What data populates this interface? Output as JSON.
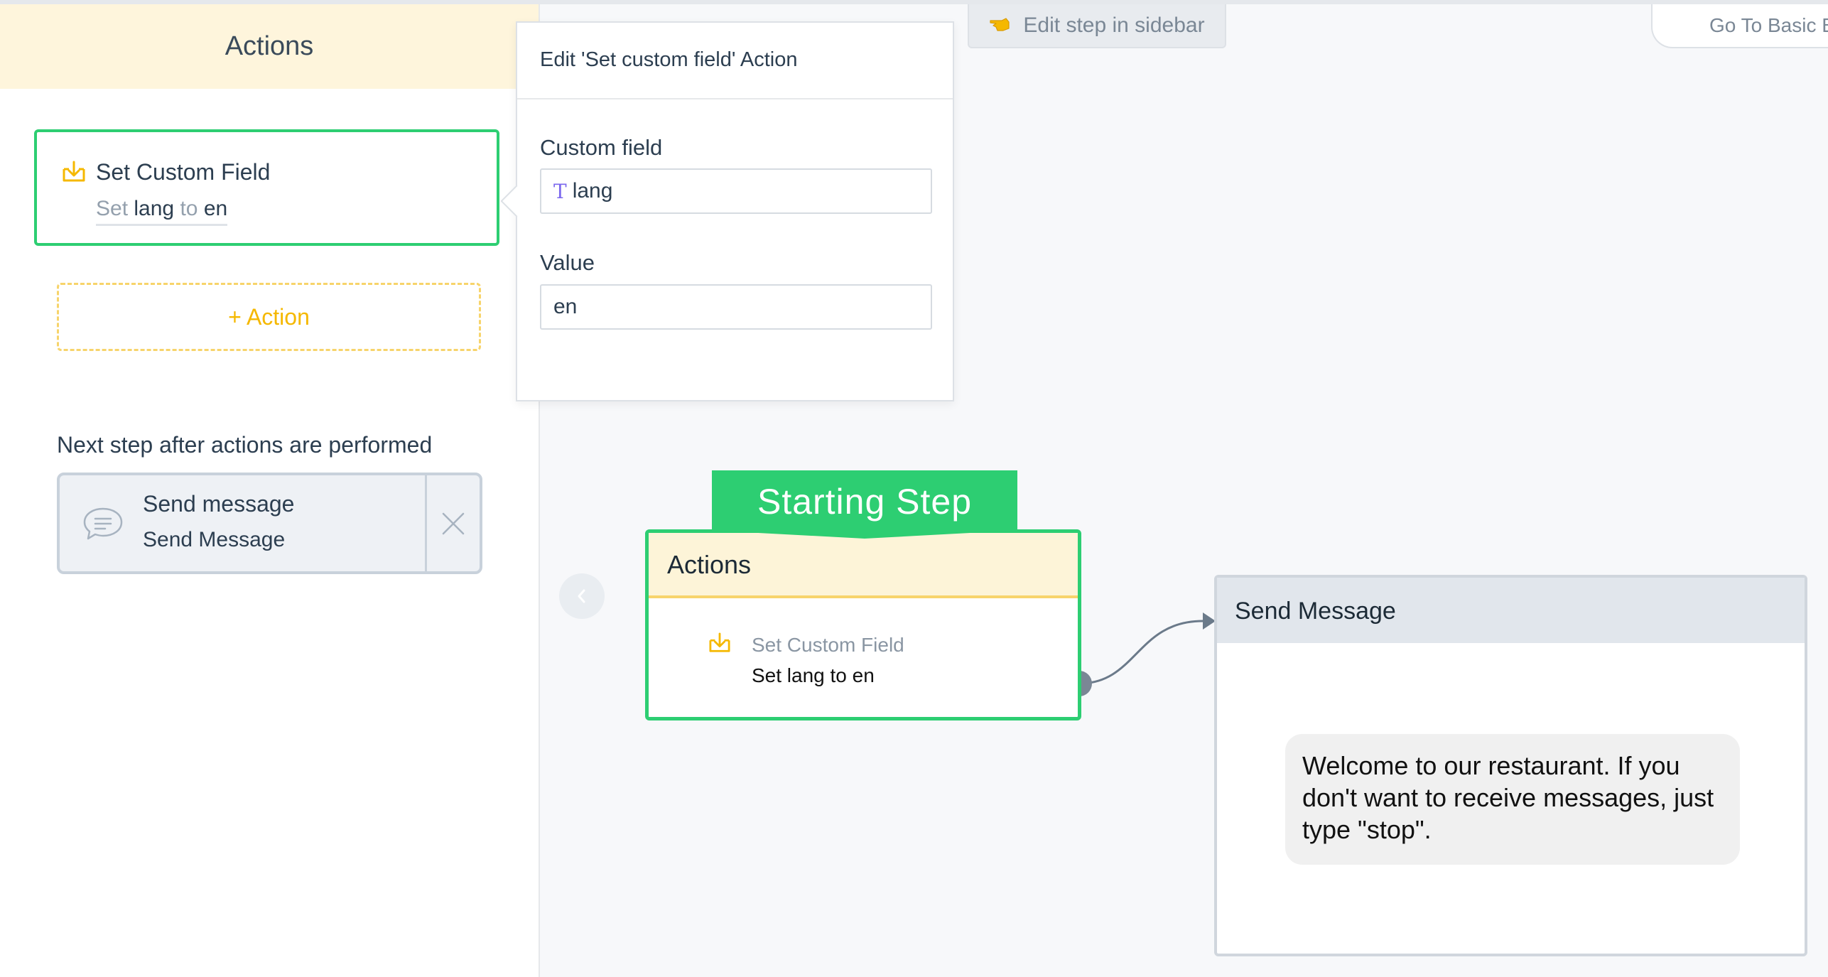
{
  "sidebar": {
    "title": "Actions",
    "action_card": {
      "title": "Set Custom Field",
      "desc_set": "Set",
      "desc_field": "lang",
      "desc_to": "to",
      "desc_value": "en"
    },
    "add_action_label": "+ Action",
    "next_step_label": "Next step after actions are performed",
    "next_step": {
      "title": "Send message",
      "subtitle": "Send Message"
    }
  },
  "popover": {
    "title": "Edit 'Set custom field' Action",
    "custom_field_label": "Custom field",
    "custom_field_value": "lang",
    "value_label": "Value",
    "value_value": "en"
  },
  "toolbar": {
    "edit_sidebar_label": "Edit step in sidebar",
    "basic_builder_label": "Go To Basic B"
  },
  "canvas": {
    "start_banner": "Starting Step",
    "start_node": {
      "header": "Actions",
      "action_title": "Set Custom Field",
      "action_desc": "Set lang to en"
    },
    "send_node": {
      "header": "Send Message",
      "message": "Welcome to our restaurant. If you don't want to receive messages, just type \"stop\"."
    }
  },
  "colors": {
    "accent_green": "#2dce72",
    "action_yellow": "#f5b800",
    "header_cream": "#fef5dc",
    "node_gray": "#e1e6ec"
  }
}
